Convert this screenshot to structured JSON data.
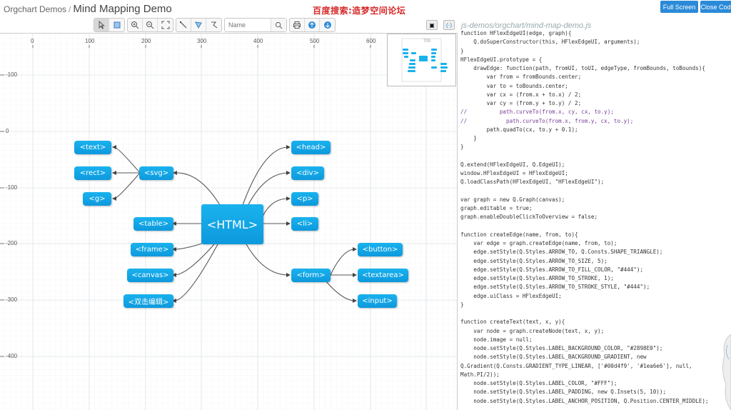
{
  "header": {
    "breadcrumb_root": "Orgchart Demos",
    "separator": "/",
    "title": "Mind Mapping Demo",
    "watermark": "百度搜索:造梦空间论坛"
  },
  "top_buttons": {
    "fullscreen": "Full Screen",
    "close_code": "Close Code"
  },
  "toolbar": {
    "search_placeholder": "Name",
    "icons": [
      "pointer-icon",
      "rubberband-select-icon",
      "zoom-in-icon",
      "zoom-out-icon",
      "zoom-fit-icon",
      "edge-tool-icon",
      "polygon-tool-icon",
      "lasso-tool-icon",
      "search-icon",
      "print-icon",
      "export-icon",
      "download-icon"
    ]
  },
  "ruler": {
    "x_labels": [
      "0",
      "100",
      "200",
      "300",
      "400",
      "500",
      "600"
    ],
    "y_labels": [
      "-100",
      "0",
      "-100",
      "-200",
      "-300",
      "-400"
    ]
  },
  "mindmap": {
    "root": "<HTML>",
    "nodes": {
      "text": "<text>",
      "rect": "<rect>",
      "g": "<g>",
      "svg": "<svg>",
      "table": "<table>",
      "frame": "<frame>",
      "canvas": "<canvas>",
      "edit": "<双击编辑>",
      "head": "<head>",
      "div": "<div>",
      "p": "<p>",
      "li": "<li>",
      "form": "<form>",
      "button": "<button>",
      "textarea": "<textarea>",
      "input": "<input>"
    }
  },
  "overview": {
    "mini_label": "700",
    "btn1": "▣",
    "btn2": "(·)"
  },
  "code_panel": {
    "file_path": "js-demos/orgchart/mind-map-demo.js",
    "lines": [
      "function HFlexEdgeUI(edge, graph){",
      "    Q.doSuperConstructor(this, HFlexEdgeUI, arguments);",
      "}",
      "HFlexEdgeUI.prototype = {",
      "    drawEdge: function(path, fromUI, toUI, edgeType, fromBounds, toBounds){",
      "        var from = fromBounds.center;",
      "        var to = toBounds.center;",
      "        var cx = (from.x + to.x) / 2;",
      "        var cy = (from.y + to.y) / 2;",
      "//          path.curveTo(from.x, cy, cx, to.y);",
      "//            path.curveTo(from.x, from.y, cx, to.y);",
      "        path.quadTo(cx, to.y + 0.1);",
      "    }",
      "}",
      "",
      "Q.extend(HFlexEdgeUI, Q.EdgeUI);",
      "window.HFlexEdgeUI = HFlexEdgeUI;",
      "Q.loadClassPath(HFlexEdgeUI, \"HFlexEdgeUI\");",
      "",
      "var graph = new Q.Graph(canvas);",
      "graph.editable = true;",
      "graph.enableDoubleClickToOverview = false;",
      "",
      "function createEdge(name, from, to){",
      "    var edge = graph.createEdge(name, from, to);",
      "    edge.setStyle(Q.Styles.ARROW_TO, Q.Consts.SHAPE_TRIANGLE);",
      "    edge.setStyle(Q.Styles.ARROW_TO_SIZE, 5);",
      "    edge.setStyle(Q.Styles.ARROW_TO_FILL_COLOR, \"#444\");",
      "    edge.setStyle(Q.Styles.ARROW_TO_STROKE, 1);",
      "    edge.setStyle(Q.Styles.ARROW_TO_STROKE_STYLE, \"#444\");",
      "    edge.uiClass = HFlexEdgeUI;",
      "}",
      "",
      "function createText(text, x, y){",
      "    var node = graph.createNode(text, x, y);",
      "    node.image = null;",
      "    node.setStyle(Q.Styles.LABEL_BACKGROUND_COLOR, \"#2898E0\");",
      "    node.setStyle(Q.Styles.LABEL_BACKGROUND_GRADIENT, new",
      "Q.Gradient(Q.Consts.GRADIENT_TYPE_LINEAR, ['#00d4f9', '#1ea6e6'], null,",
      "Math.PI/2));",
      "    node.setStyle(Q.Styles.LABEL_COLOR, \"#FFF\");",
      "    node.setStyle(Q.Styles.LABEL_PADDING, new Q.Insets(5, 10));",
      "    node.setStyle(Q.Styles.LABEL_ANCHOR_POSITION, Q.Position.CENTER_MIDDLE);"
    ]
  },
  "colors": {
    "node_top": "#19b2ee",
    "node_bottom": "#0e99dd",
    "accent_button": "#2b8ad8",
    "watermark": "#d62828"
  }
}
